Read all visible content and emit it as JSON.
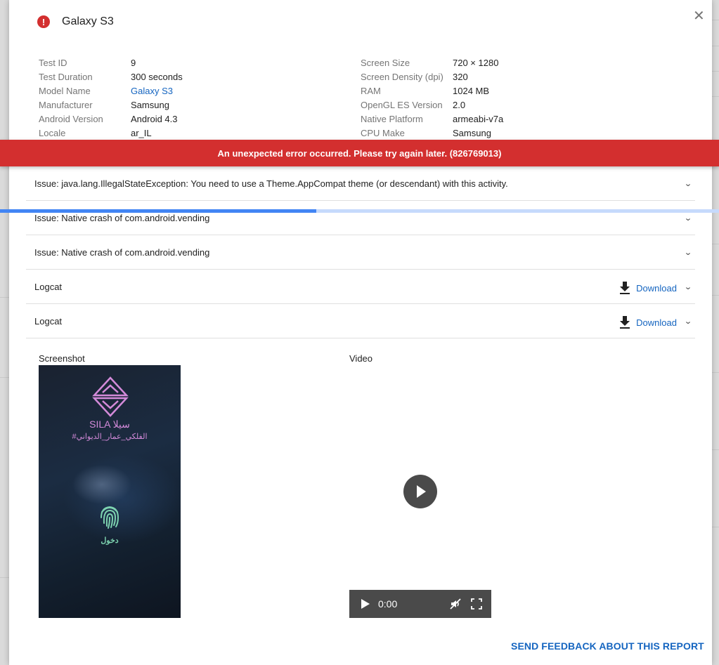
{
  "dialog": {
    "title": "Galaxy S3",
    "close_icon": "close-icon",
    "status_icon": "error-icon"
  },
  "device_info": {
    "left": [
      {
        "label": "Test ID",
        "value": "9"
      },
      {
        "label": "Test Duration",
        "value": "300 seconds"
      },
      {
        "label": "Model Name",
        "value": "Galaxy S3",
        "link": true
      },
      {
        "label": "Manufacturer",
        "value": "Samsung"
      },
      {
        "label": "Android Version",
        "value": "Android 4.3"
      },
      {
        "label": "Locale",
        "value": "ar_IL"
      }
    ],
    "right": [
      {
        "label": "Screen Size",
        "value": "720 × 1280"
      },
      {
        "label": "Screen Density (dpi)",
        "value": "320"
      },
      {
        "label": "RAM",
        "value": "1024 MB"
      },
      {
        "label": "OpenGL ES Version",
        "value": "2.0"
      },
      {
        "label": "Native Platform",
        "value": "armeabi-v7a"
      },
      {
        "label": "CPU Make",
        "value": "Samsung"
      }
    ]
  },
  "error_banner": {
    "message": "An unexpected error occurred. Please try again later. (826769013)",
    "color": "#d32f2f"
  },
  "loading_progress": {
    "percent": 44
  },
  "sections": [
    {
      "label": "Issue: java.lang.IllegalStateException: You need to use a Theme.AppCompat theme (or descendant) with this activity.",
      "download": false
    },
    {
      "label": "Issue: Native crash of com.android.vending",
      "download": false
    },
    {
      "label": "Issue: Native crash of com.android.vending",
      "download": false
    },
    {
      "label": "Logcat",
      "download": true,
      "download_label": "Download"
    },
    {
      "label": "Logcat",
      "download": true,
      "download_label": "Download"
    }
  ],
  "media": {
    "screenshot_label": "Screenshot",
    "video_label": "Video",
    "screenshot_content": {
      "brand": "SILA سيلا",
      "hashtag": "#الفلكي_عمار_الديواني",
      "login": "دخول"
    },
    "video": {
      "time": "0:00"
    }
  },
  "footer": {
    "feedback_label": "SEND FEEDBACK ABOUT THIS REPORT"
  },
  "colors": {
    "accent": "#1565c0",
    "error": "#d32f2f",
    "progress": "#4285f4",
    "progress_track": "#c6dafc"
  }
}
